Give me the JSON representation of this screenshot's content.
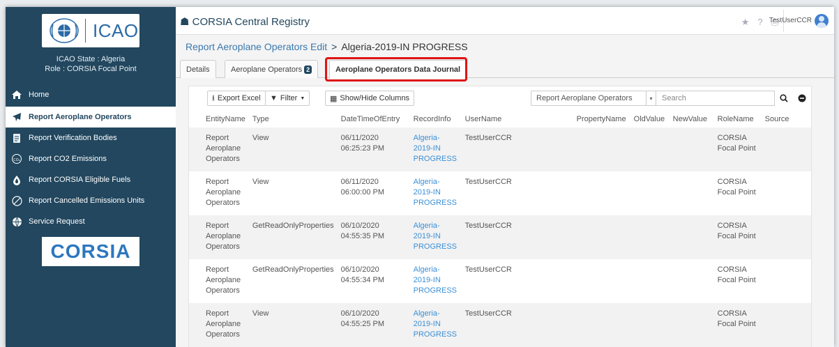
{
  "sidebar": {
    "logo_text": "ICAO",
    "state_line": "ICAO State : Algeria",
    "role_line": "Role : CORSIA Focal Point",
    "items": [
      {
        "label": "Home",
        "icon": "home-icon"
      },
      {
        "label": "Report Aeroplane Operators",
        "icon": "plane-icon"
      },
      {
        "label": "Report Verification Bodies",
        "icon": "document-icon"
      },
      {
        "label": "Report CO2 Emissions",
        "icon": "co2-icon"
      },
      {
        "label": "Report CORSIA Eligible Fuels",
        "icon": "fuel-drop-icon"
      },
      {
        "label": "Report Cancelled Emissions Units",
        "icon": "cancel-circle-icon"
      },
      {
        "label": "Service Request",
        "icon": "globe-icon"
      }
    ],
    "corsia_logo_text": "CORSIA"
  },
  "header": {
    "app_title": "CORSIA Central Registry",
    "user_name": "TestUserCCR"
  },
  "breadcrumb": {
    "parent": "Report Aeroplane Operators Edit",
    "separator": ">",
    "current": "Algeria-2019-IN PROGRESS"
  },
  "tabs": [
    {
      "label": "Details"
    },
    {
      "label": "Aeroplane Operators",
      "badge": "2"
    },
    {
      "label": "Aeroplane Operators Data Journal"
    }
  ],
  "toolbar": {
    "export_label": "Export Excel",
    "filter_label": "Filter",
    "columns_label": "Show/Hide Columns",
    "entity_select_value": "Report Aeroplane Operators",
    "search_placeholder": "Search"
  },
  "table": {
    "headers": [
      "EntityName",
      "Type",
      "DateTimeOfEntry",
      "RecordInfo",
      "UserName",
      "PropertyName",
      "OldValue",
      "NewValue",
      "RoleName",
      "Source"
    ],
    "rows": [
      {
        "entity": "Report Aeroplane Operators",
        "type": "View",
        "date": "06/11/2020",
        "time": "06:25:23 PM",
        "record": "Algeria-2019-IN PROGRESS",
        "user": "TestUserCCR",
        "role": "CORSIA Focal Point"
      },
      {
        "entity": "Report Aeroplane Operators",
        "type": "View",
        "date": "06/11/2020",
        "time": "06:00:00 PM",
        "record": "Algeria-2019-IN PROGRESS",
        "user": "TestUserCCR",
        "role": "CORSIA Focal Point"
      },
      {
        "entity": "Report Aeroplane Operators",
        "type": "GetReadOnlyProperties",
        "date": "06/10/2020",
        "time": "04:55:35 PM",
        "record": "Algeria-2019-IN PROGRESS",
        "user": "TestUserCCR",
        "role": "CORSIA Focal Point"
      },
      {
        "entity": "Report Aeroplane Operators",
        "type": "GetReadOnlyProperties",
        "date": "06/10/2020",
        "time": "04:55:34 PM",
        "record": "Algeria-2019-IN PROGRESS",
        "user": "TestUserCCR",
        "role": "CORSIA Focal Point"
      },
      {
        "entity": "Report Aeroplane Operators",
        "type": "View",
        "date": "06/10/2020",
        "time": "04:55:25 PM",
        "record": "Algeria-2019-IN PROGRESS",
        "user": "TestUserCCR",
        "role": "CORSIA Focal Point"
      }
    ]
  },
  "colors": {
    "sidebar_bg": "#22475f",
    "link": "#3a8ed6",
    "highlight": "#e01414"
  }
}
